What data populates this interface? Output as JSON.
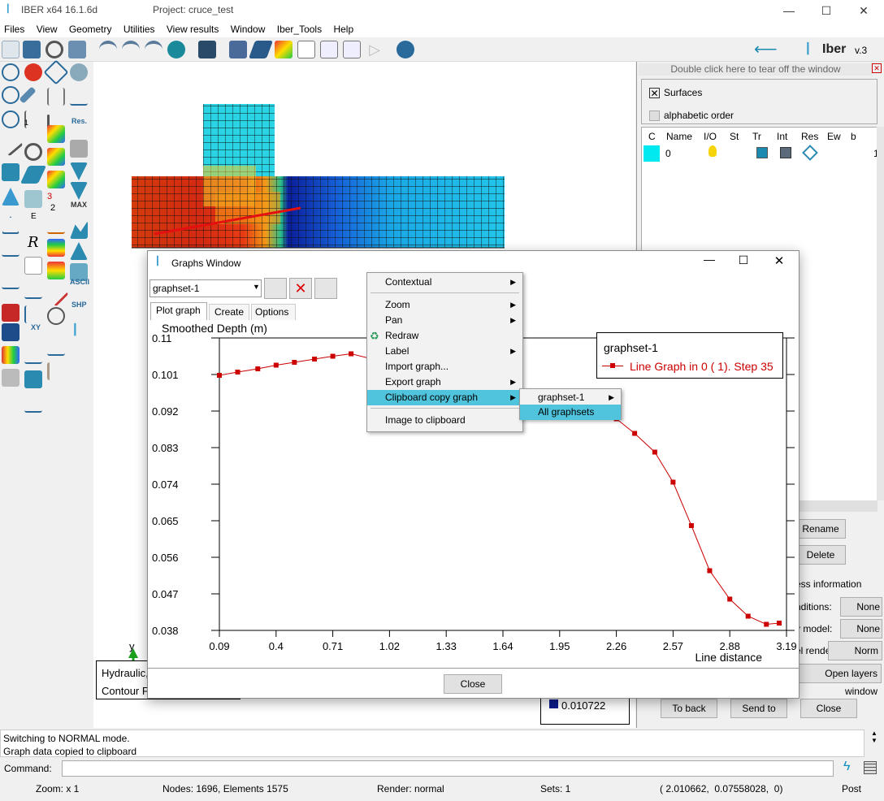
{
  "titlebar": {
    "app": "IBER x64 16.1.6d",
    "project": "Project: cruce_test"
  },
  "menu": [
    "Files",
    "View",
    "Geometry",
    "Utilities",
    "View results",
    "Window",
    "Iber_Tools",
    "Help"
  ],
  "brand": {
    "name": "Iber",
    "version": "v.3"
  },
  "left_labels": {
    "res": "Res.",
    "max": "MAX",
    "ascii": "ASCII",
    "shp": "SHP",
    "xy": "XY",
    "n1": "1",
    "n3": "3",
    "n2": "2",
    "E": "E",
    "R": "R"
  },
  "right_panel": {
    "tear_off": "Double click here to tear off the window",
    "surfaces_label": "Surfaces",
    "alphabetic_label": "alphabetic order",
    "columns": [
      "C",
      "Name",
      "I/O",
      "St",
      "Tr",
      "Int",
      "Res",
      "Ew",
      "b"
    ],
    "row": {
      "name": "0",
      "tail": "1"
    },
    "rename": "Rename",
    "delete": "Delete",
    "process_info": "ess information",
    "conditions_label": "nditions:",
    "conditions_val": "None",
    "model_label": "v model:",
    "model_val": "None",
    "render_label": "el render:",
    "render_val": "Norm",
    "open_layers": "Open layers window",
    "to_back": "To back",
    "send_to": "Send to",
    "close": "Close"
  },
  "canvas_legend": {
    "line1": "Hydraulic, Step 35",
    "line2": "Contour Fill of Depth (m).",
    "value": "0.010722",
    "axis_y": "y"
  },
  "graph_window": {
    "title": "Graphs Window",
    "graphset": "graphset-1",
    "tabs": [
      "Plot graph",
      "Create",
      "Options"
    ],
    "close_button": "Close",
    "legend_title": "graphset-1",
    "legend_entry": "Line Graph in 0 ( 1). Step 35",
    "accent": "#cc0000"
  },
  "chart_data": {
    "type": "line",
    "title": "Smoothed Depth (m)",
    "xlabel": "Line distance",
    "ylabel": "",
    "x_ticks": [
      "0.09",
      "0.4",
      "0.71",
      "1.02",
      "1.33",
      "1.64",
      "1.95",
      "2.26",
      "2.57",
      "2.88",
      "3.19"
    ],
    "y_ticks": [
      "0.11",
      "0.101",
      "0.092",
      "0.083",
      "0.074",
      "0.065",
      "0.056",
      "0.047",
      "0.038"
    ],
    "xlim": [
      0.09,
      3.19
    ],
    "ylim": [
      0.038,
      0.11
    ],
    "series": [
      {
        "name": "Line Graph in 0 ( 1). Step 35",
        "x": [
          0.09,
          0.19,
          0.3,
          0.4,
          0.5,
          0.61,
          0.71,
          0.81,
          2.26,
          2.36,
          2.47,
          2.57,
          2.67,
          2.77,
          2.88,
          2.98,
          3.08,
          3.15
        ],
        "y": [
          0.1008,
          0.1016,
          0.1024,
          0.1033,
          0.104,
          0.1048,
          0.1055,
          0.1061,
          0.0901,
          0.0865,
          0.0819,
          0.0745,
          0.0638,
          0.0527,
          0.0457,
          0.0415,
          0.0395,
          0.0398
        ]
      }
    ]
  },
  "context_menu": {
    "items": [
      "Contextual",
      "Zoom",
      "Pan",
      "Redraw",
      "Label",
      "Import graph...",
      "Export graph",
      "Clipboard copy graph",
      "Image to clipboard"
    ],
    "submenu": [
      "graphset-1",
      "All graphsets"
    ]
  },
  "status": {
    "log1": "Switching to NORMAL mode.",
    "log2": "Graph data copied to clipboard",
    "command_label": "Command:",
    "zoom": "Zoom: x 1",
    "nodes": "Nodes: 1696, Elements 1575",
    "render": "Render: normal",
    "sets": "Sets: 1",
    "coords": "( 2.010662,  0.07558028,  0)",
    "mode": "Post"
  }
}
